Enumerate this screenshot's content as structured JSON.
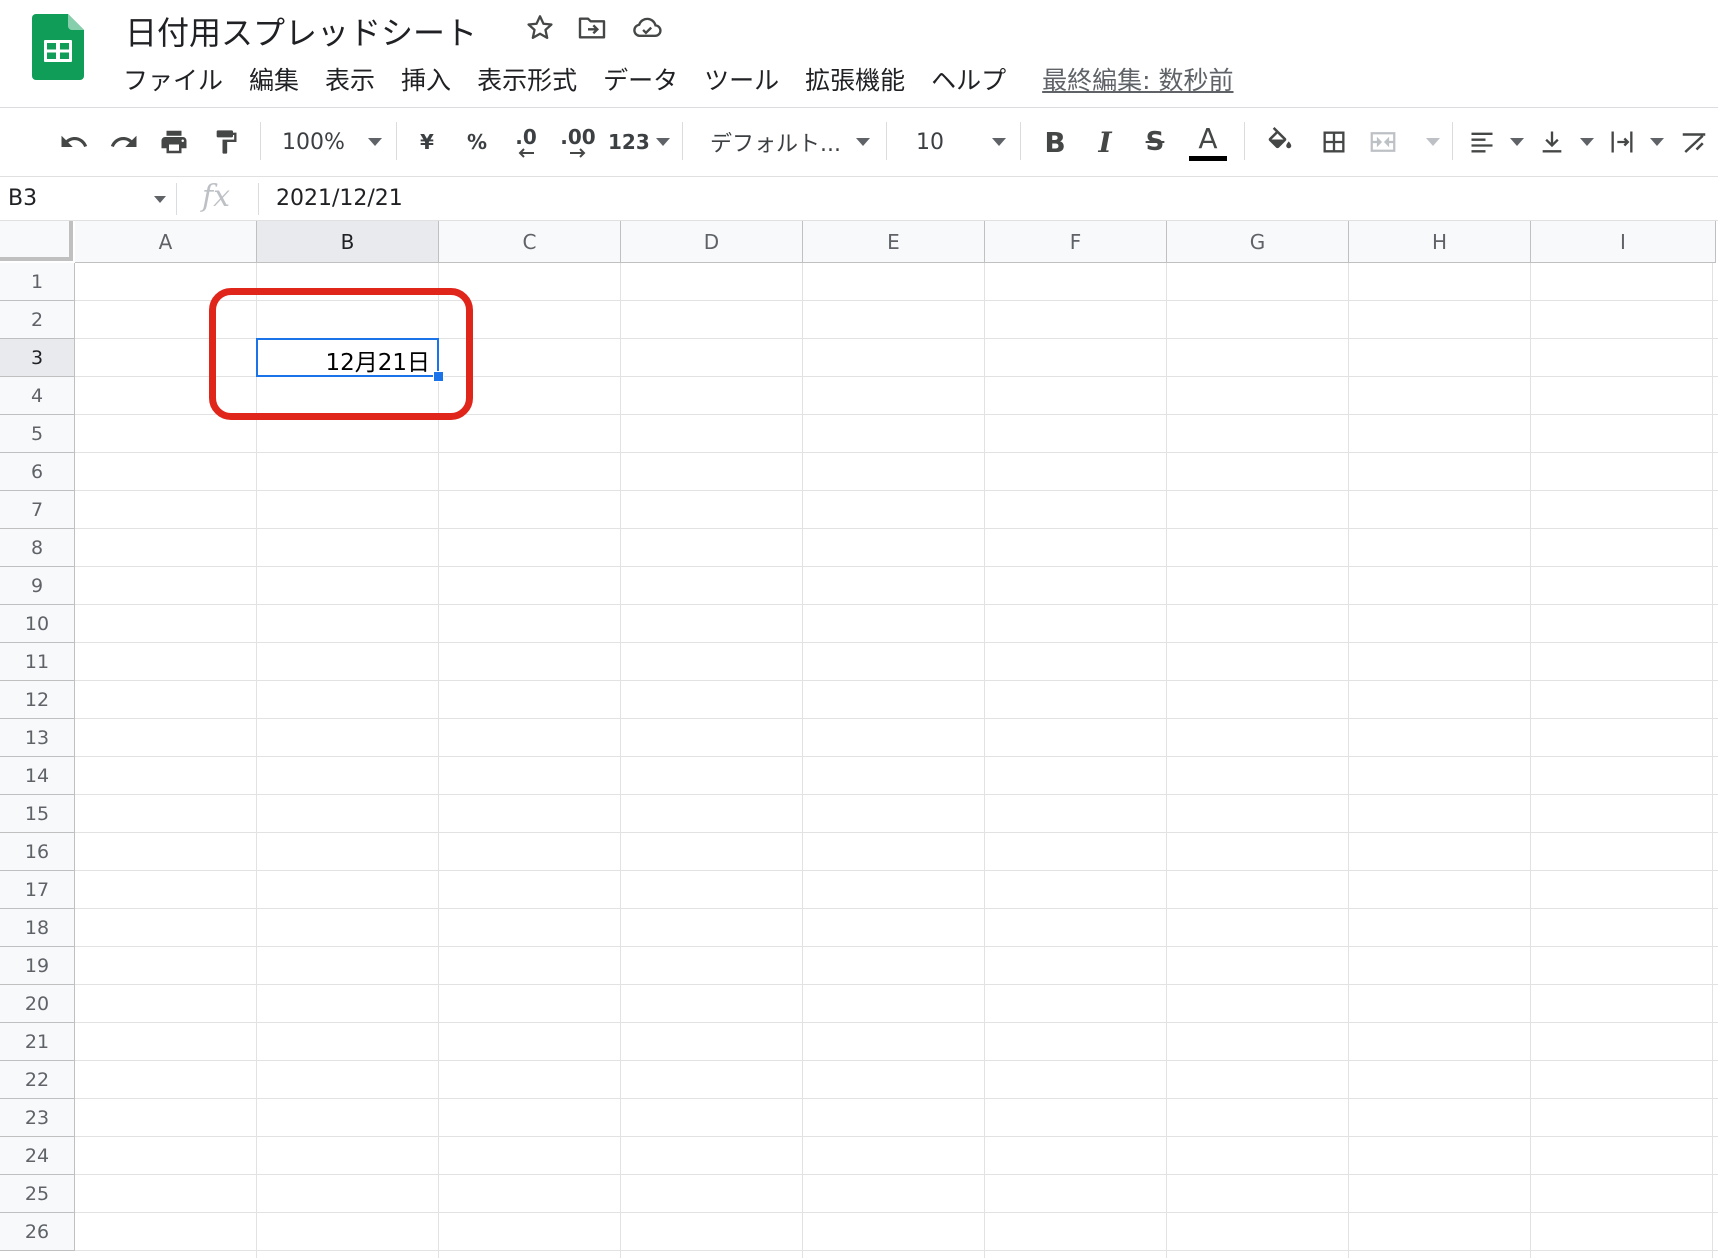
{
  "app": {
    "title": "日付用スプレッドシート",
    "brand_color": "#0f9d58"
  },
  "title_icons": [
    "star-icon",
    "move-to-folder-icon",
    "cloud-saved-icon"
  ],
  "menu": {
    "items": [
      "ファイル",
      "編集",
      "表示",
      "挿入",
      "表示形式",
      "データ",
      "ツール",
      "拡張機能",
      "ヘルプ"
    ],
    "last_edit": "最終編集: 数秒前"
  },
  "toolbar": {
    "zoom": "100%",
    "currency": "¥",
    "percent": "%",
    "decrease_decimal": ".0",
    "increase_decimal": ".00",
    "more_formats": "123",
    "font": "デフォルト...",
    "font_size": "10",
    "bold": "B",
    "italic": "I",
    "strikethrough": "S",
    "text_color": "A"
  },
  "formula_bar": {
    "cell_ref": "B3",
    "fx": "fx",
    "value": "2021/12/21"
  },
  "grid": {
    "columns": [
      "A",
      "B",
      "C",
      "D",
      "E",
      "F",
      "G",
      "H",
      "I"
    ],
    "rows": [
      "1",
      "2",
      "3",
      "4",
      "5",
      "6",
      "7",
      "8",
      "9",
      "10",
      "11",
      "12",
      "13",
      "14",
      "15",
      "16",
      "17",
      "18",
      "19",
      "20",
      "21",
      "22",
      "23",
      "24",
      "25",
      "26"
    ],
    "active_column": "B",
    "active_row": "3",
    "selected_cell": {
      "ref": "B3",
      "display": "12月21日"
    }
  },
  "colors": {
    "selection": "#1a73e8",
    "annotation": "#e0251b"
  }
}
